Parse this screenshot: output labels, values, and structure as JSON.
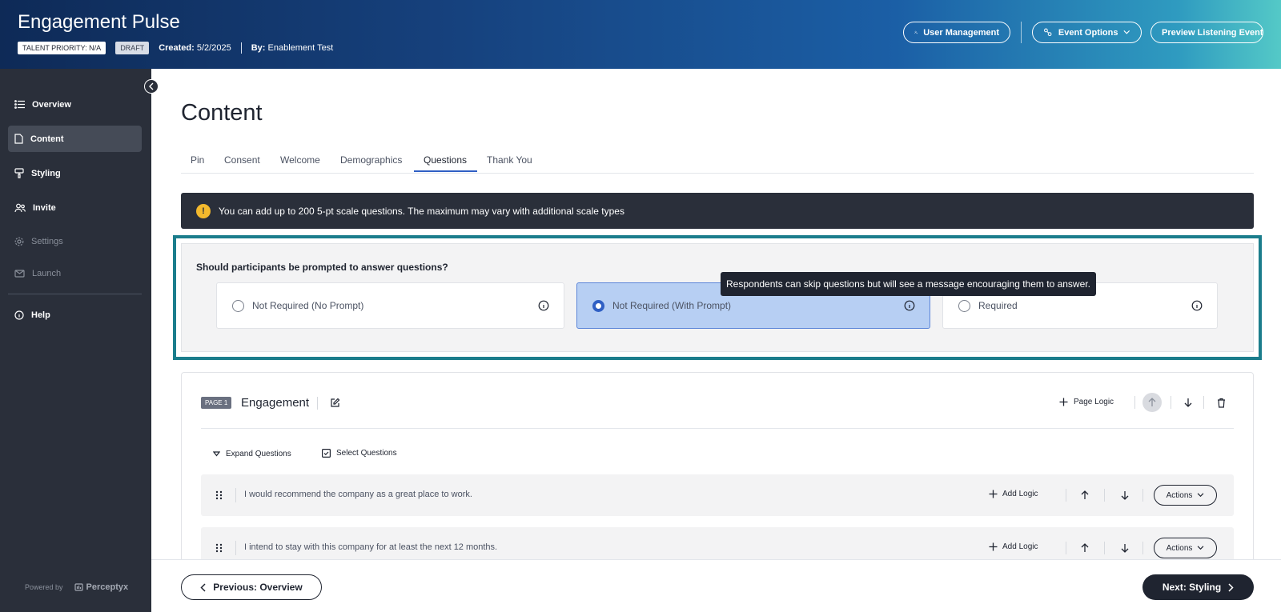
{
  "header": {
    "title": "Engagement Pulse",
    "talent_priority": "TALENT PRIORITY: N/A",
    "status": "DRAFT",
    "created_label": "Created:",
    "created_value": "5/2/2025",
    "by_label": "By:",
    "by_value": "Enablement Test",
    "buttons": {
      "user_management": "User Management",
      "event_options": "Event Options",
      "preview": "Preview Listening Event"
    }
  },
  "sidebar": {
    "items": [
      {
        "label": "Overview",
        "icon": "list-icon"
      },
      {
        "label": "Content",
        "icon": "document-icon"
      },
      {
        "label": "Styling",
        "icon": "paint-icon"
      },
      {
        "label": "Invite",
        "icon": "users-icon"
      },
      {
        "label": "Settings",
        "icon": "gear-icon"
      },
      {
        "label": "Launch",
        "icon": "mail-icon"
      },
      {
        "label": "Help",
        "icon": "info-icon"
      }
    ],
    "powered_by": "Powered by",
    "brand": "Perceptyx"
  },
  "main": {
    "title": "Content",
    "tabs": [
      "Pin",
      "Consent",
      "Welcome",
      "Demographics",
      "Questions",
      "Thank You"
    ],
    "active_tab": "Questions",
    "banner_text": "You can add up to 200 5-pt scale questions. The maximum may vary with additional scale types",
    "prompt": {
      "question": "Should participants be prompted to answer questions?",
      "options": [
        "Not Required (No Prompt)",
        "Not Required (With Prompt)",
        "Required"
      ],
      "selected": "Not Required (With Prompt)",
      "tooltip": "Respondents can skip questions but will see a message encouraging them to answer."
    },
    "page": {
      "badge": "PAGE 1",
      "name": "Engagement",
      "page_logic": "Page Logic",
      "expand_questions": "Expand Questions",
      "select_questions": "Select Questions",
      "questions": [
        {
          "text": "I would recommend the company as a great place to work.",
          "add_logic": "Add Logic",
          "actions": "Actions"
        },
        {
          "text": "I intend to stay with this company for at least the next 12 months.",
          "add_logic": "Add Logic",
          "actions": "Actions"
        }
      ]
    },
    "footer": {
      "prev": "Previous: Overview",
      "next": "Next: Styling"
    }
  },
  "colors": {
    "accent": "#2f5fc4",
    "highlight": "#1b7d8c",
    "sidebar": "#2a2f3a",
    "selected_option": "#b7cff3",
    "warning": "#f3b92d"
  }
}
